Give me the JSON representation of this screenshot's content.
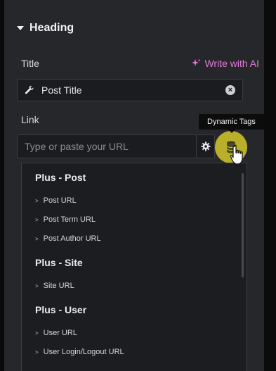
{
  "section": {
    "title": "Heading"
  },
  "title_field": {
    "label": "Title",
    "ai_label": "Write with AI",
    "value": "Post Title"
  },
  "link_field": {
    "label": "Link",
    "placeholder": "Type or paste your URL"
  },
  "tooltip": "Dynamic Tags",
  "dropdown": {
    "groups": [
      {
        "label": "Plus - Post",
        "items": [
          "Post URL",
          "Post Term URL",
          "Post Author URL"
        ]
      },
      {
        "label": "Plus - Site",
        "items": [
          "Site URL"
        ]
      },
      {
        "label": "Plus - User",
        "items": [
          "User URL",
          "User Login/Logout URL"
        ]
      }
    ]
  },
  "colors": {
    "panel": "#26272b",
    "accent_ai": "#e07ad6",
    "highlight": "#d4c828",
    "input_bg": "#1b1c20"
  },
  "icons": [
    "caret-down-icon",
    "sparkle-icon",
    "wrench-icon",
    "clear-icon",
    "gear-icon",
    "database-icon",
    "hand-cursor-icon"
  ]
}
